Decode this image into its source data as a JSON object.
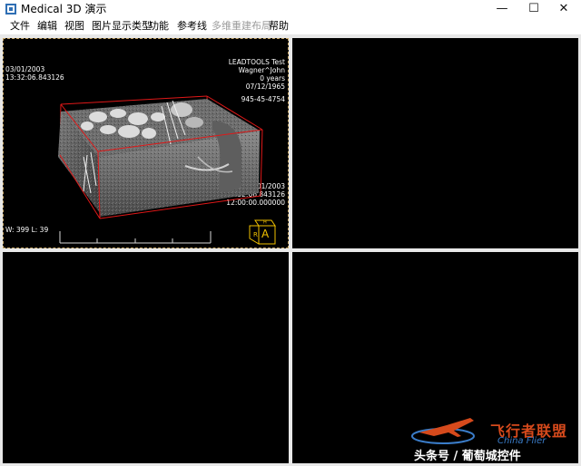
{
  "window": {
    "title": "Medical 3D 演示",
    "minimize_glyph": "—",
    "maximize_glyph": "☐",
    "close_glyph": "✕"
  },
  "menu": [
    {
      "label": "文件",
      "enabled": true
    },
    {
      "label": "编辑",
      "enabled": true
    },
    {
      "label": "视图",
      "enabled": true
    },
    {
      "label": "图片显示类型",
      "enabled": true
    },
    {
      "label": "功能",
      "enabled": true
    },
    {
      "label": "参考线",
      "enabled": true
    },
    {
      "label": "多维重建布局",
      "enabled": false
    },
    {
      "label": "帮助",
      "enabled": true
    }
  ],
  "viewport1": {
    "top_left": {
      "date": "03/01/2003",
      "time": "13:32:06.843126"
    },
    "top_right": {
      "line1": "LEADTOOLS Test",
      "line2": "Wagner^John",
      "line3": "0 years",
      "line4": "07/12/1965",
      "line5": "945-45-4754"
    },
    "bottom_right": {
      "line1": "03/01/2003",
      "line2": "13:32:06.843126",
      "line3": "12:00:00.000000"
    },
    "window_level": "W: 399 L: 39",
    "orientation_label": "A",
    "bounding_box_color": "#e01818",
    "orientation_cube_color": "#f2c200"
  },
  "watermark": {
    "cn": "飞行者联盟",
    "en": "China Flier",
    "credit": "头条号 / 葡萄城控件"
  }
}
